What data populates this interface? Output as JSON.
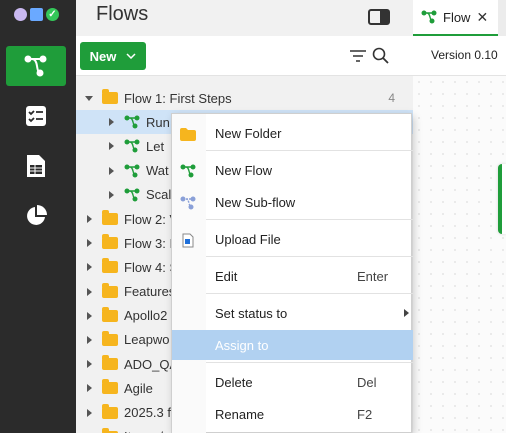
{
  "rail": {
    "items": [
      {
        "icon": "flows-icon",
        "active": true
      },
      {
        "icon": "checklist-icon",
        "active": false
      },
      {
        "icon": "report-icon",
        "active": false
      },
      {
        "icon": "pie-chart-icon",
        "active": false
      }
    ]
  },
  "panel": {
    "title": "Flows",
    "new_label": "New"
  },
  "tree": [
    {
      "label": "Flow 1: First Steps",
      "type": "folder",
      "expanded": true,
      "level": 0,
      "count": "4"
    },
    {
      "label": "Run",
      "type": "flow",
      "level": 1,
      "selected": true
    },
    {
      "label": "Let",
      "type": "flow",
      "level": 1
    },
    {
      "label": "Wat",
      "type": "flow",
      "level": 1
    },
    {
      "label": "Scal",
      "type": "flow",
      "level": 1
    },
    {
      "label": "Flow 2: V",
      "type": "folder",
      "level": 0
    },
    {
      "label": "Flow 3: I",
      "type": "folder",
      "level": 0
    },
    {
      "label": "Flow 4: S",
      "type": "folder",
      "level": 0
    },
    {
      "label": "Features",
      "type": "folder",
      "level": 0
    },
    {
      "label": "Apollo2",
      "type": "folder",
      "level": 0
    },
    {
      "label": "Leapwo",
      "type": "folder",
      "level": 0
    },
    {
      "label": "ADO_QA",
      "type": "folder",
      "level": 0
    },
    {
      "label": "Agile",
      "type": "folder",
      "level": 0
    },
    {
      "label": "2025.3 f",
      "type": "folder",
      "level": 0
    },
    {
      "label": "Items / ",
      "type": "folder",
      "level": 0
    }
  ],
  "editor": {
    "tab_label": "Flow",
    "version_label": "Version 0.10"
  },
  "menu": {
    "items": [
      {
        "label": "New Folder",
        "icon": "folder-icon",
        "key": ""
      },
      {
        "label": "New Flow",
        "icon": "flow-icon",
        "key": ""
      },
      {
        "label": "New Sub-flow",
        "icon": "subflow-icon",
        "key": ""
      },
      {
        "label": "Upload File",
        "icon": "upload-file-icon",
        "key": ""
      },
      {
        "label": "Edit",
        "icon": "",
        "key": "Enter"
      },
      {
        "label": "Set status to",
        "icon": "",
        "key": "",
        "submenu": true
      },
      {
        "label": "Assign to",
        "icon": "",
        "key": "",
        "highlighted": true
      },
      {
        "label": "Delete",
        "icon": "",
        "key": "Del"
      },
      {
        "label": "Rename",
        "icon": "",
        "key": "F2"
      }
    ]
  },
  "colors": {
    "accent": "#1f9d3a",
    "rail_bg": "#2b2b2b",
    "folder": "#f6b51e",
    "selection": "#cfe3f7",
    "menu_highlight": "#b1d1f1"
  }
}
